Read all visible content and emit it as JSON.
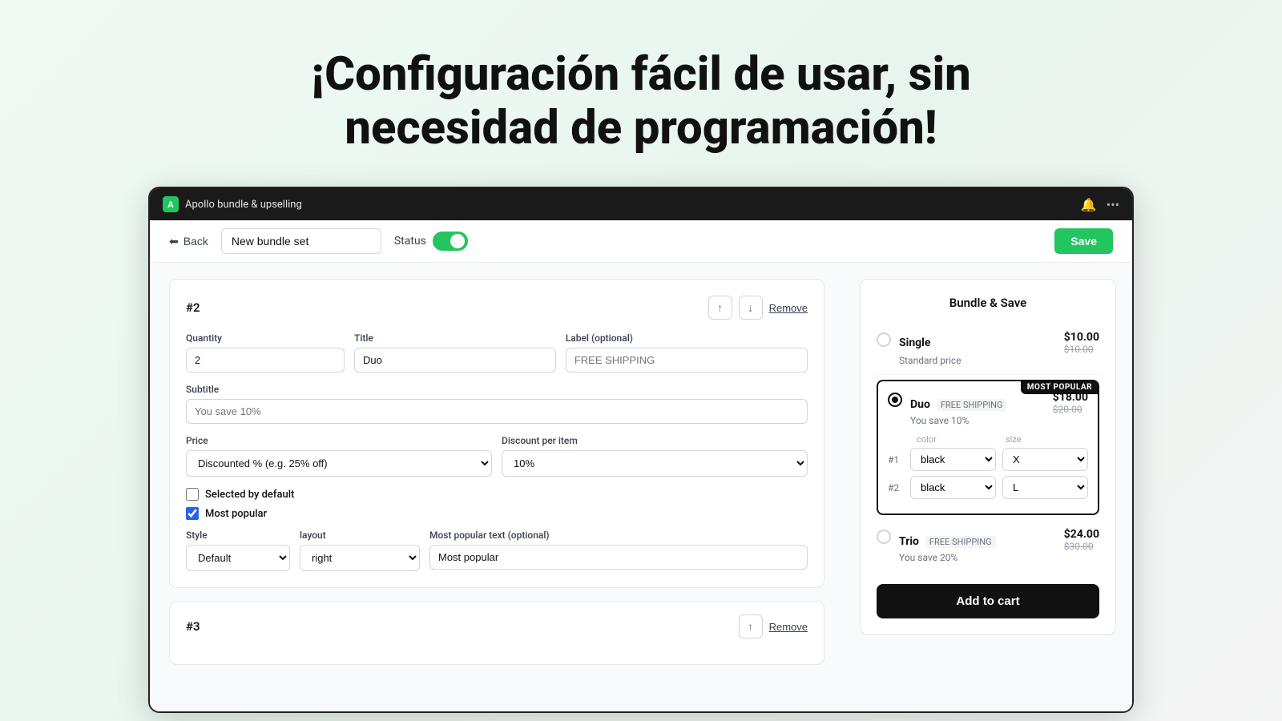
{
  "hero": {
    "title": "¡Configuración fácil de usar, sin necesidad de programación!"
  },
  "titlebar": {
    "app_name": "Apollo bundle & upselling",
    "logo_letter": "A"
  },
  "toolbar": {
    "back_label": "Back",
    "bundle_name": "New bundle set",
    "status_label": "Status",
    "save_label": "Save"
  },
  "bundle2": {
    "number": "#2",
    "quantity_label": "Quantity",
    "quantity_value": "2",
    "title_label": "Title",
    "title_value": "Duo",
    "label_label": "Label (optional)",
    "label_placeholder": "FREE SHIPPING",
    "subtitle_label": "Subtitle",
    "subtitle_placeholder": "You save 10%",
    "price_label": "Price",
    "price_value": "Discounted % (e.g. 25% off)",
    "discount_label": "Discount per item",
    "discount_value": "10%",
    "selected_default_label": "Selected by default",
    "most_popular_label": "Most popular",
    "style_label": "Style",
    "style_value": "Default",
    "layout_label": "layout",
    "layout_value": "right",
    "popular_text_label": "Most popular text (optional)",
    "popular_text_value": "Most popular",
    "remove_label": "Remove"
  },
  "bundle3": {
    "number": "#3",
    "remove_label": "Remove"
  },
  "preview": {
    "title": "Bundle & Save",
    "single": {
      "name": "Single",
      "subtitle": "Standard price",
      "price": "$10.00",
      "original_price": "$10.00"
    },
    "duo": {
      "name": "Duo",
      "badge": "FREE SHIPPING",
      "subtitle": "You save 10%",
      "price": "$18.00",
      "original_price": "$20.00",
      "most_popular": "MOST POPULAR",
      "color_label": "color",
      "size_label": "size",
      "item1_num": "#1",
      "item2_num": "#2",
      "item1_color": "black",
      "item1_size": "X",
      "item2_color": "black",
      "item2_size": "L"
    },
    "trio": {
      "name": "Trio",
      "badge": "FREE SHIPPING",
      "subtitle": "You save 20%",
      "price": "$24.00",
      "original_price": "$30.00"
    },
    "add_to_cart": "Add to cart"
  }
}
